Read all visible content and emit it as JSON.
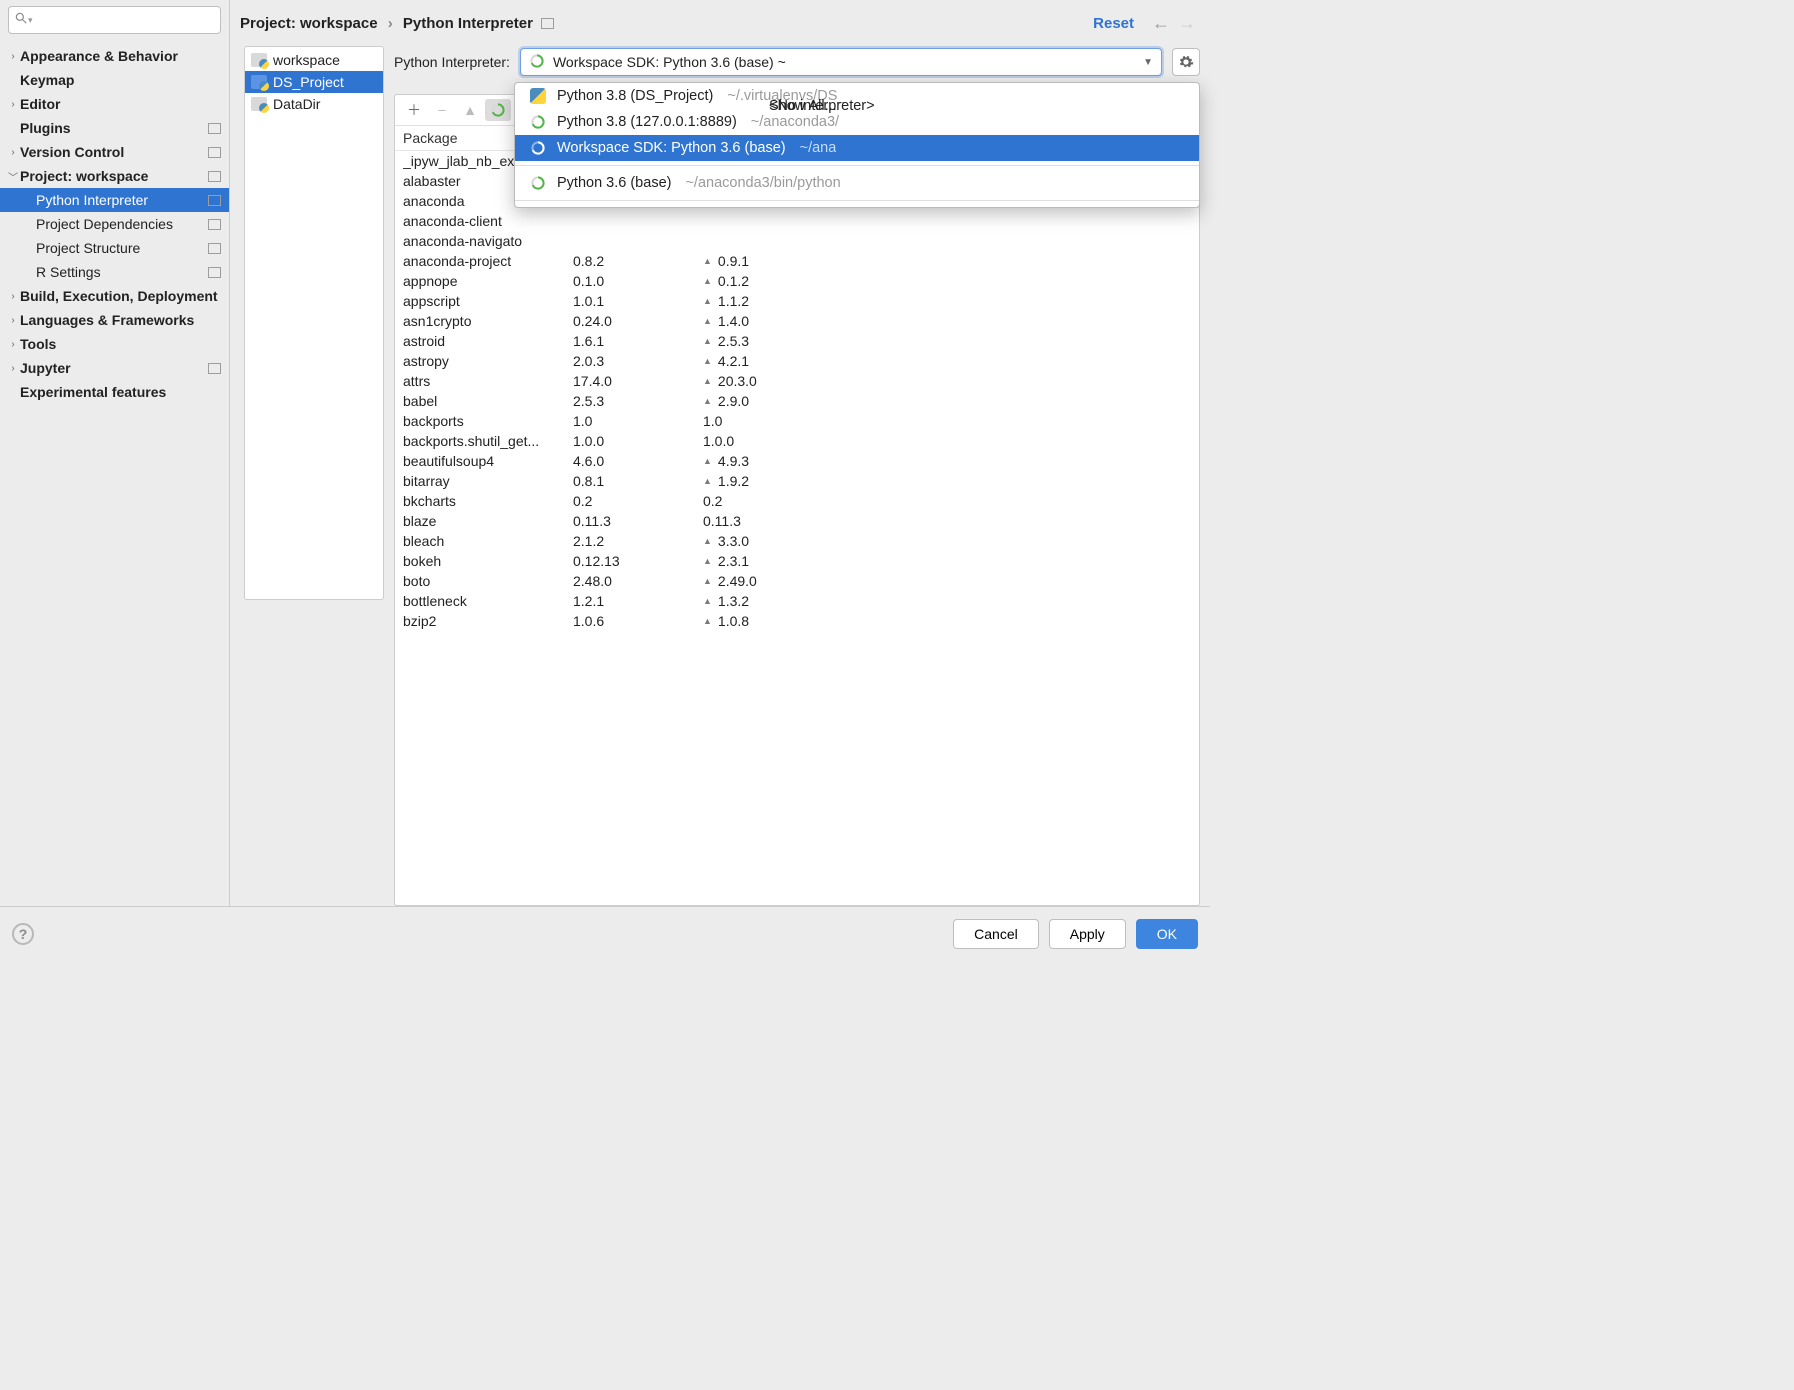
{
  "header": {
    "breadcrumb_root": "Project: workspace",
    "breadcrumb_leaf": "Python Interpreter",
    "reset": "Reset"
  },
  "search": {
    "placeholder": ""
  },
  "sidebar": {
    "items": [
      {
        "label": "Appearance & Behavior",
        "expandable": true,
        "bold": true
      },
      {
        "label": "Keymap",
        "bold": true
      },
      {
        "label": "Editor",
        "expandable": true,
        "bold": true
      },
      {
        "label": "Plugins",
        "bold": true,
        "badge": true
      },
      {
        "label": "Version Control",
        "expandable": true,
        "bold": true,
        "badge": true
      },
      {
        "label": "Project: workspace",
        "expandable": true,
        "expanded": true,
        "bold": true,
        "badge": true
      },
      {
        "label": "Python Interpreter",
        "level": 2,
        "selected": true,
        "badge": true
      },
      {
        "label": "Project Dependencies",
        "level": 2,
        "badge": true
      },
      {
        "label": "Project Structure",
        "level": 2,
        "badge": true
      },
      {
        "label": "R Settings",
        "level": 2,
        "badge": true
      },
      {
        "label": "Build, Execution, Deployment",
        "expandable": true,
        "bold": true
      },
      {
        "label": "Languages & Frameworks",
        "expandable": true,
        "bold": true
      },
      {
        "label": "Tools",
        "expandable": true,
        "bold": true
      },
      {
        "label": "Jupyter",
        "expandable": true,
        "bold": true,
        "badge": true
      },
      {
        "label": "Experimental features",
        "bold": true
      }
    ]
  },
  "project_tree": {
    "items": [
      {
        "label": "workspace"
      },
      {
        "label": "DS_Project",
        "selected": true
      },
      {
        "label": "DataDir"
      }
    ]
  },
  "interpreter": {
    "label": "Python Interpreter:",
    "selected_text": "Workspace SDK: Python 3.6 (base) ~",
    "dropdown": {
      "no_interp": "<No interpreter>",
      "options": [
        {
          "icon": "python",
          "label": "Python 3.8 (DS_Project)",
          "path": "~/.virtualenvs/DS_"
        },
        {
          "icon": "ring",
          "label": "Python 3.8 (127.0.0.1:8889)",
          "path": "~/anaconda3/"
        },
        {
          "icon": "ring",
          "label": "Workspace SDK: Python 3.6 (base)",
          "path": "~/ana",
          "selected": true
        },
        {
          "break": true
        },
        {
          "icon": "ring",
          "label": "Python 3.6 (base)",
          "path": "~/anaconda3/bin/python"
        }
      ],
      "show_all": "Show All..."
    }
  },
  "pkg_toolbar": {
    "header": "Package"
  },
  "packages": [
    {
      "name": "_ipyw_jlab_nb_ext_",
      "ver": "",
      "latest": "",
      "up": false
    },
    {
      "name": "alabaster",
      "ver": "",
      "latest": "",
      "up": false
    },
    {
      "name": "anaconda",
      "ver": "",
      "latest": "",
      "up": false
    },
    {
      "name": "anaconda-client",
      "ver": "",
      "latest": "",
      "up": false
    },
    {
      "name": "anaconda-navigato",
      "ver": "",
      "latest": "",
      "up": false
    },
    {
      "name": "anaconda-project",
      "ver": "0.8.2",
      "latest": "0.9.1",
      "up": true
    },
    {
      "name": "appnope",
      "ver": "0.1.0",
      "latest": "0.1.2",
      "up": true
    },
    {
      "name": "appscript",
      "ver": "1.0.1",
      "latest": "1.1.2",
      "up": true
    },
    {
      "name": "asn1crypto",
      "ver": "0.24.0",
      "latest": "1.4.0",
      "up": true
    },
    {
      "name": "astroid",
      "ver": "1.6.1",
      "latest": "2.5.3",
      "up": true
    },
    {
      "name": "astropy",
      "ver": "2.0.3",
      "latest": "4.2.1",
      "up": true
    },
    {
      "name": "attrs",
      "ver": "17.4.0",
      "latest": "20.3.0",
      "up": true
    },
    {
      "name": "babel",
      "ver": "2.5.3",
      "latest": "2.9.0",
      "up": true
    },
    {
      "name": "backports",
      "ver": "1.0",
      "latest": "1.0",
      "up": false
    },
    {
      "name": "backports.shutil_get...",
      "ver": "1.0.0",
      "latest": "1.0.0",
      "up": false
    },
    {
      "name": "beautifulsoup4",
      "ver": "4.6.0",
      "latest": "4.9.3",
      "up": true
    },
    {
      "name": "bitarray",
      "ver": "0.8.1",
      "latest": "1.9.2",
      "up": true
    },
    {
      "name": "bkcharts",
      "ver": "0.2",
      "latest": "0.2",
      "up": false
    },
    {
      "name": "blaze",
      "ver": "0.11.3",
      "latest": "0.11.3",
      "up": false
    },
    {
      "name": "bleach",
      "ver": "2.1.2",
      "latest": "3.3.0",
      "up": true
    },
    {
      "name": "bokeh",
      "ver": "0.12.13",
      "latest": "2.3.1",
      "up": true
    },
    {
      "name": "boto",
      "ver": "2.48.0",
      "latest": "2.49.0",
      "up": true
    },
    {
      "name": "bottleneck",
      "ver": "1.2.1",
      "latest": "1.3.2",
      "up": true
    },
    {
      "name": "bzip2",
      "ver": "1.0.6",
      "latest": "1.0.8",
      "up": true
    }
  ],
  "footer": {
    "cancel": "Cancel",
    "apply": "Apply",
    "ok": "OK"
  }
}
